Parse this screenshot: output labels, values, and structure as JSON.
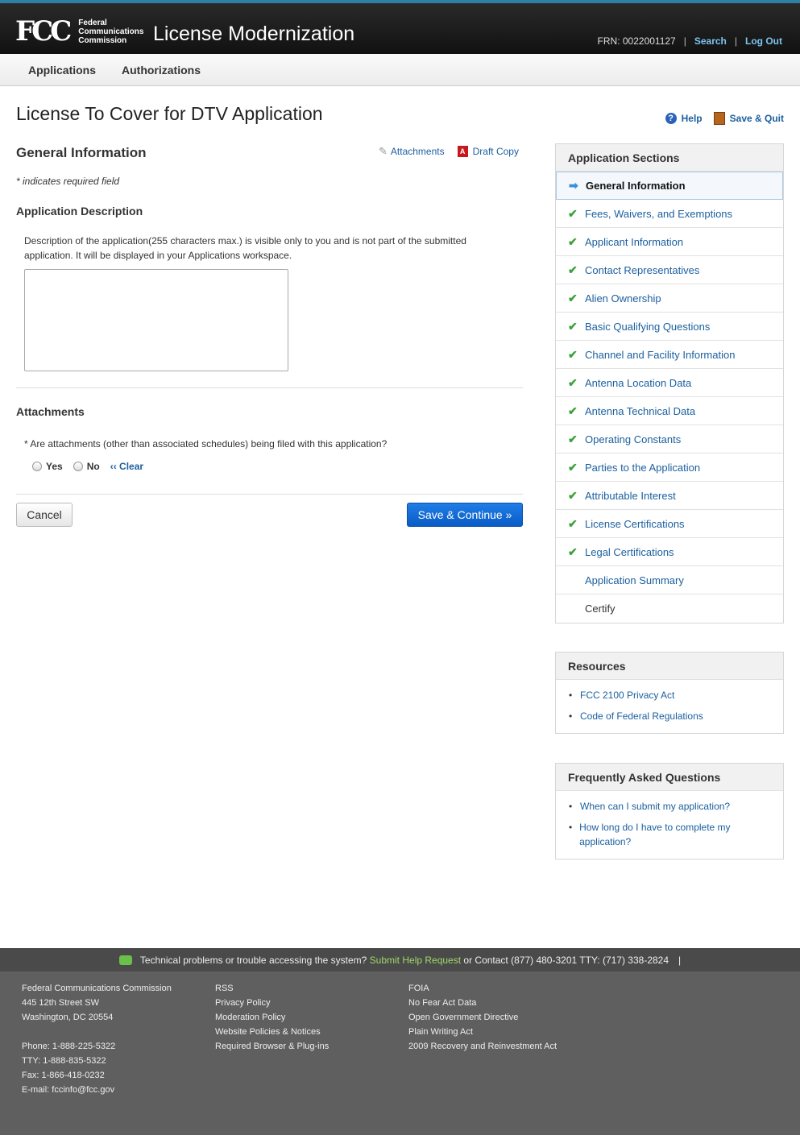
{
  "header": {
    "logo": "FCC",
    "agency_lines": [
      "Federal",
      "Communications",
      "Commission"
    ],
    "app_title": "License Modernization",
    "frn": "FRN: 0022001127",
    "search": "Search",
    "logout": "Log Out",
    "separator": "|"
  },
  "nav": {
    "applications": "Applications",
    "authorizations": "Authorizations"
  },
  "page": {
    "title": "License To Cover for DTV Application",
    "help": "Help",
    "save_quit": "Save & Quit",
    "section": "General Information",
    "attachments_link": "Attachments",
    "draft_copy": "Draft Copy",
    "required_note": "* indicates required field",
    "app_desc_heading": "Application Description",
    "app_desc_text": "Description of the application(255 characters max.) is visible only to you and is not part of the submitted application. It will be displayed in your Applications workspace.",
    "attachments_heading": "Attachments",
    "attachments_question": "* Are attachments (other than associated schedules) being filed with this application?",
    "yes": "Yes",
    "no": "No",
    "clear": "‹‹ Clear",
    "cancel": "Cancel",
    "save_continue": "Save & Continue »"
  },
  "sections": {
    "heading": "Application Sections",
    "items": [
      {
        "label": "General Information",
        "state": "active"
      },
      {
        "label": "Fees, Waivers, and Exemptions",
        "state": "done"
      },
      {
        "label": "Applicant Information",
        "state": "done"
      },
      {
        "label": "Contact Representatives",
        "state": "done"
      },
      {
        "label": "Alien Ownership",
        "state": "done"
      },
      {
        "label": "Basic Qualifying Questions",
        "state": "done"
      },
      {
        "label": "Channel and Facility Information",
        "state": "done"
      },
      {
        "label": "Antenna Location Data",
        "state": "done"
      },
      {
        "label": "Antenna Technical Data",
        "state": "done"
      },
      {
        "label": "Operating Constants",
        "state": "done"
      },
      {
        "label": "Parties to the Application",
        "state": "done"
      },
      {
        "label": "Attributable Interest",
        "state": "done"
      },
      {
        "label": "License Certifications",
        "state": "done"
      },
      {
        "label": "Legal Certifications",
        "state": "done"
      },
      {
        "label": "Application Summary",
        "state": "link"
      },
      {
        "label": "Certify",
        "state": "plain"
      }
    ]
  },
  "resources": {
    "heading": "Resources",
    "items": [
      "FCC 2100 Privacy Act",
      "Code of Federal Regulations"
    ]
  },
  "faq": {
    "heading": "Frequently Asked Questions",
    "items": [
      "When can I submit my application?",
      "How long do I have to complete my application?"
    ]
  },
  "footer": {
    "help_text": "Technical problems or trouble accessing the system?",
    "help_link": "Submit Help Request",
    "contact": "or Contact (877) 480-3201 TTY: (717) 338-2824",
    "bar_sep": "|",
    "col1": [
      "Federal Communications Commission",
      "445 12th Street SW",
      "Washington, DC 20554"
    ],
    "col1b": [
      "Phone: 1-888-225-5322",
      "TTY: 1-888-835-5322",
      "Fax: 1-866-418-0232",
      "E-mail: fccinfo@fcc.gov"
    ],
    "col2": [
      "RSS",
      "Privacy Policy",
      "Moderation Policy",
      "Website Policies & Notices",
      "Required Browser & Plug-ins"
    ],
    "col3": [
      "FOIA",
      "No Fear Act Data",
      "Open Government Directive",
      "Plain Writing Act",
      "2009 Recovery and Reinvestment Act"
    ]
  },
  "colors": {
    "accent": "#1a5f9e",
    "primary_button": "#0a5bc6",
    "check": "#3aa13a",
    "footer_link": "#9fd86a"
  }
}
